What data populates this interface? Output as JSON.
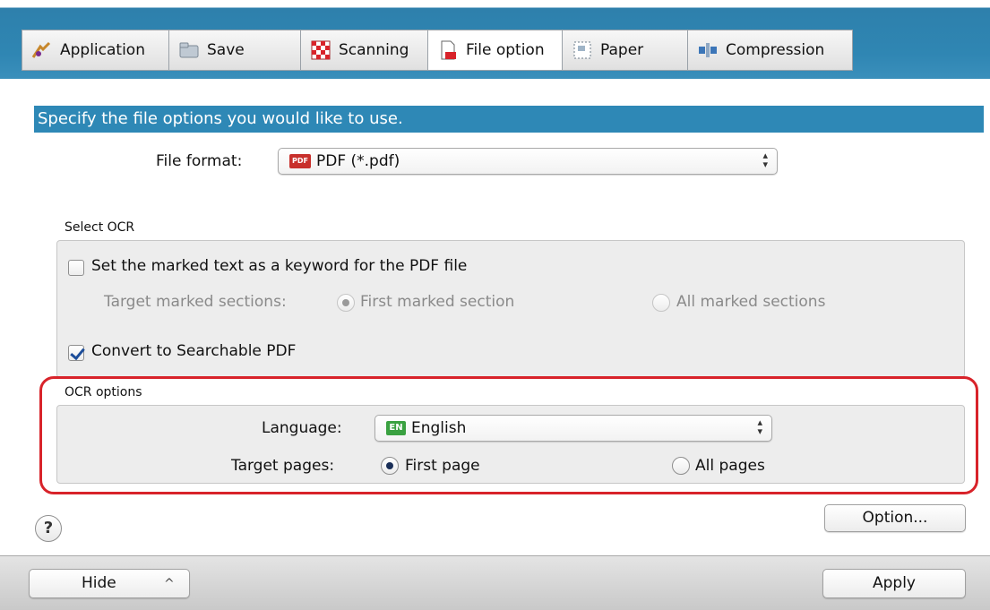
{
  "tabs": [
    {
      "label": "Application",
      "icon": "application-icon",
      "active": false
    },
    {
      "label": "Save",
      "icon": "folder-icon",
      "active": false
    },
    {
      "label": "Scanning",
      "icon": "scanning-icon",
      "active": false
    },
    {
      "label": "File option",
      "icon": "file-icon",
      "active": true
    },
    {
      "label": "Paper",
      "icon": "paper-icon",
      "active": false
    },
    {
      "label": "Compression",
      "icon": "compression-icon",
      "active": false
    }
  ],
  "heading": "Specify the file options you would like to use.",
  "file_format": {
    "label": "File format:",
    "value": "PDF (*.pdf)",
    "badge": "PDF"
  },
  "select_ocr": {
    "title": "Select OCR",
    "keyword_checkbox": {
      "label": "Set the marked text as a keyword for the PDF file",
      "checked": false
    },
    "target_sections": {
      "label": "Target marked sections:",
      "options": [
        {
          "label": "First marked section",
          "selected": true
        },
        {
          "label": "All marked sections",
          "selected": false
        }
      ]
    },
    "searchable_checkbox": {
      "label": "Convert to Searchable PDF",
      "checked": true
    }
  },
  "ocr_options": {
    "title": "OCR options",
    "language": {
      "label": "Language:",
      "value": "English",
      "badge": "EN"
    },
    "target_pages": {
      "label": "Target pages:",
      "options": [
        {
          "label": "First page",
          "selected": true
        },
        {
          "label": "All pages",
          "selected": false
        }
      ]
    }
  },
  "help_label": "?",
  "option_button": "Option...",
  "footer": {
    "hide_button": "Hide",
    "hide_chevron": "^",
    "apply_button": "Apply"
  },
  "colors": {
    "accent": "#2e88b6",
    "highlight": "#d8232a",
    "pdf_badge": "#c8302c",
    "en_badge": "#3aa141"
  }
}
